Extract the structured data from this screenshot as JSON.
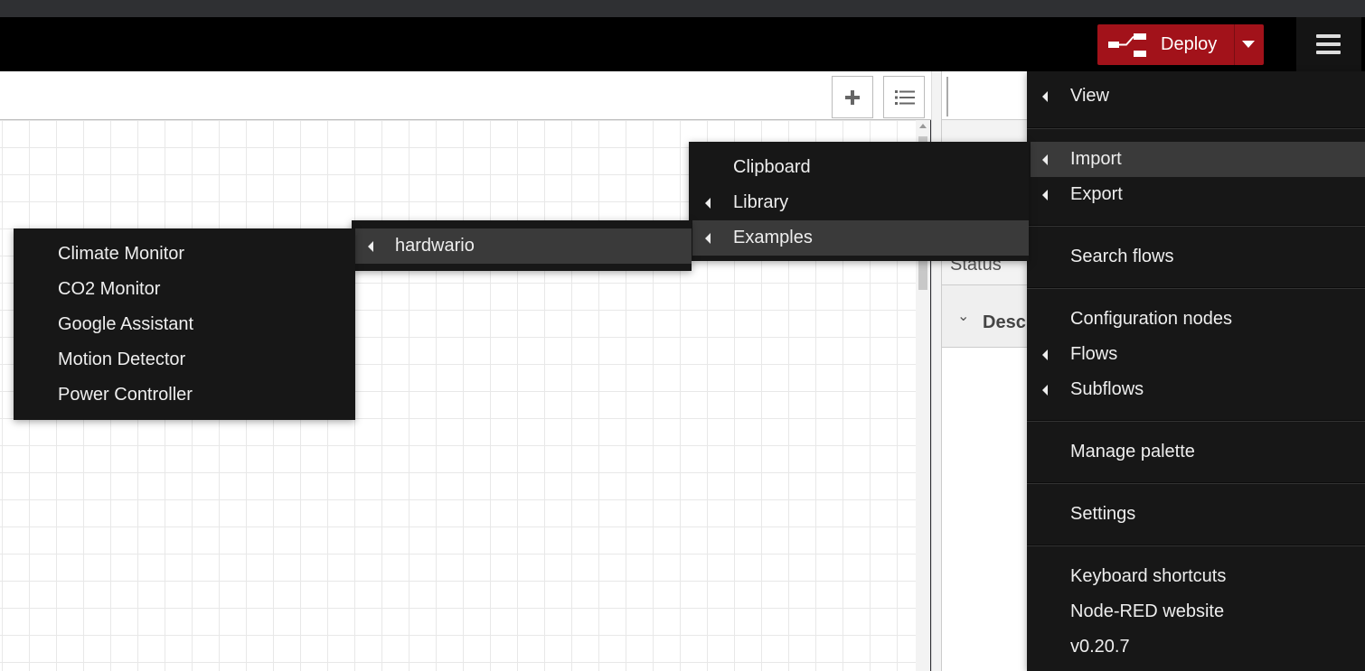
{
  "header": {
    "deploy_label": "Deploy"
  },
  "main_menu": {
    "items": [
      {
        "label": "View"
      },
      {
        "label": "Import"
      },
      {
        "label": "Export"
      },
      {
        "label": "Search flows"
      },
      {
        "label": "Configuration nodes"
      },
      {
        "label": "Flows"
      },
      {
        "label": "Subflows"
      },
      {
        "label": "Manage palette"
      },
      {
        "label": "Settings"
      },
      {
        "label": "Keyboard shortcuts"
      },
      {
        "label": "Node-RED website"
      },
      {
        "label": "v0.20.7"
      }
    ]
  },
  "import_menu": {
    "items": [
      {
        "label": "Clipboard"
      },
      {
        "label": "Library"
      },
      {
        "label": "Examples"
      }
    ]
  },
  "examples_menu": {
    "items": [
      {
        "label": "hardwario"
      }
    ]
  },
  "hardwario_menu": {
    "items": [
      {
        "label": "Climate Monitor"
      },
      {
        "label": "CO2 Monitor"
      },
      {
        "label": "Google Assistant"
      },
      {
        "label": "Motion Detector"
      },
      {
        "label": "Power Controller"
      }
    ]
  },
  "sidebar": {
    "status_label": "Status",
    "description_label": "Desc"
  },
  "colors": {
    "deploy": "#a2121a",
    "menu_bg": "#171717",
    "menu_active": "#3a3a3a"
  }
}
